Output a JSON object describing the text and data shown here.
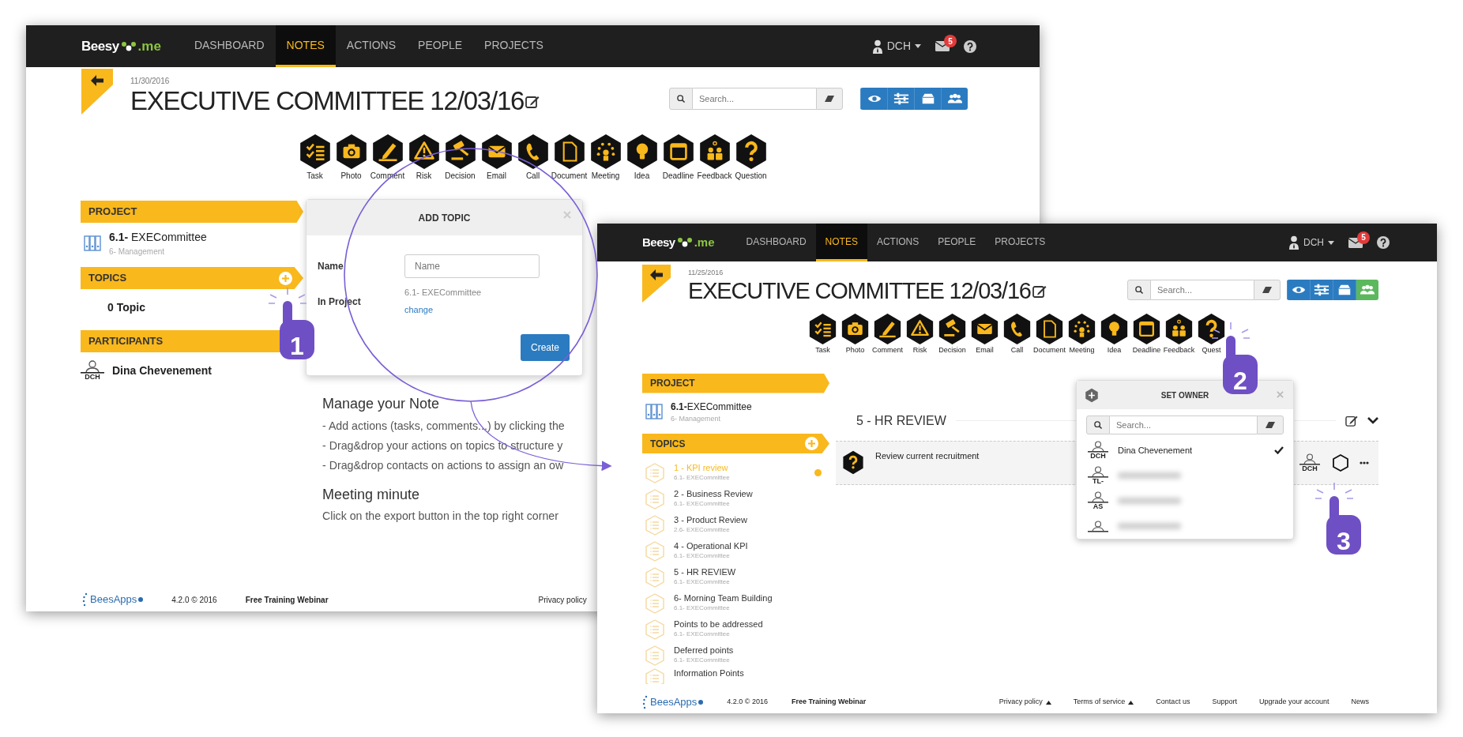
{
  "back_window": {
    "navbar": {
      "logo_name": "Beesy",
      "logo_suffix": ".me",
      "items": [
        {
          "label": "DASHBOARD",
          "selected": false
        },
        {
          "label": "NOTES",
          "selected": true
        },
        {
          "label": "ACTIONS",
          "selected": false
        },
        {
          "label": "PEOPLE",
          "selected": false
        },
        {
          "label": "PROJECTS",
          "selected": false
        }
      ],
      "user": "DCH",
      "mail_badge": "5"
    },
    "header": {
      "date": "11/30/2016",
      "title": "EXECUTIVE COMMITTEE 12/03/16",
      "search_placeholder": "Search...",
      "view_buttons": [
        {
          "kind": "eye",
          "active": false
        },
        {
          "kind": "sliders",
          "active": false
        },
        {
          "kind": "box",
          "active": false
        },
        {
          "kind": "people",
          "active": false
        }
      ]
    },
    "action_types": [
      {
        "label": "Task",
        "kind": "task"
      },
      {
        "label": "Photo",
        "kind": "photo"
      },
      {
        "label": "Comment",
        "kind": "comment"
      },
      {
        "label": "Risk",
        "kind": "risk"
      },
      {
        "label": "Decision",
        "kind": "decision"
      },
      {
        "label": "Email",
        "kind": "email"
      },
      {
        "label": "Call",
        "kind": "call"
      },
      {
        "label": "Document",
        "kind": "document"
      },
      {
        "label": "Meeting",
        "kind": "meeting"
      },
      {
        "label": "Idea",
        "kind": "idea"
      },
      {
        "label": "Deadline",
        "kind": "deadline"
      },
      {
        "label": "Feedback",
        "kind": "feedback"
      },
      {
        "label": "Question",
        "kind": "question"
      }
    ],
    "sidebar": {
      "project_header": "PROJECT",
      "project": {
        "name": "**6.1-** EXECommittee",
        "parent": "6- Management"
      },
      "topics_header": "TOPICS",
      "topics_empty": "0 Topic",
      "participants_header": "PARTICIPANTS",
      "participants": [
        {
          "initials": "DCH",
          "name": "Dina Chevenement"
        }
      ]
    },
    "main": [
      {
        "heading": "Manage your Note",
        "lines": [
          "- Add actions (tasks, comments...) by clicking the",
          "- Drag&drop your actions on topics to structure y",
          "- Drag&drop contacts on actions to assign an ow"
        ]
      },
      {
        "heading": "Meeting minute",
        "lines": [
          "Click on the export button in the top right corner"
        ]
      }
    ],
    "dialog": {
      "title": "ADD TOPIC",
      "name_label": "Name",
      "name_placeholder": "Name",
      "project_label": "In Project",
      "project_value": "6.1- EXECommittee",
      "change_link": "change",
      "button": "Create"
    },
    "footer": {
      "brand": "BeesApps",
      "version": "4.2.0 © 2016",
      "webinar": "Free Training Webinar",
      "links": [
        {
          "label": "Privacy policy"
        }
      ]
    }
  },
  "front_window": {
    "navbar": {
      "logo_name": "Beesy",
      "logo_suffix": ".me",
      "items": [
        {
          "label": "DASHBOARD",
          "selected": false
        },
        {
          "label": "NOTES",
          "selected": true
        },
        {
          "label": "ACTIONS",
          "selected": false
        },
        {
          "label": "PEOPLE",
          "selected": false
        },
        {
          "label": "PROJECTS",
          "selected": false
        }
      ],
      "user": "DCH",
      "mail_badge": "5"
    },
    "header": {
      "date": "11/25/2016",
      "title": "EXECUTIVE COMMITTEE 12/03/16",
      "search_placeholder": "Search...",
      "view_buttons": [
        {
          "kind": "eye",
          "active": false
        },
        {
          "kind": "sliders",
          "active": false
        },
        {
          "kind": "box",
          "active": false
        },
        {
          "kind": "people",
          "active": true
        }
      ]
    },
    "action_types": [
      {
        "label": "Task",
        "kind": "task"
      },
      {
        "label": "Photo",
        "kind": "photo"
      },
      {
        "label": "Comment",
        "kind": "comment"
      },
      {
        "label": "Risk",
        "kind": "risk"
      },
      {
        "label": "Decision",
        "kind": "decision"
      },
      {
        "label": "Email",
        "kind": "email"
      },
      {
        "label": "Call",
        "kind": "call"
      },
      {
        "label": "Document",
        "kind": "document"
      },
      {
        "label": "Meeting",
        "kind": "meeting"
      },
      {
        "label": "Idea",
        "kind": "idea"
      },
      {
        "label": "Deadline",
        "kind": "deadline"
      },
      {
        "label": "Feedback",
        "kind": "feedback"
      },
      {
        "label": "Quest",
        "kind": "question"
      }
    ],
    "sidebar": {
      "project_header": "PROJECT",
      "project": {
        "name": "**6.1-**EXECommittee",
        "parent": "6- Management"
      },
      "topics_header": "TOPICS",
      "topics": [
        {
          "title": "1 - KPI review",
          "project": "6.1- EXECommittee",
          "selected": true
        },
        {
          "title": "2 - Business Review",
          "project": "6.1- EXECommittee",
          "selected": false
        },
        {
          "title": "3 - Product Review",
          "project": "2.6- EXECommittee",
          "selected": false
        },
        {
          "title": "4 - Operational KPI",
          "project": "6.1- EXECommittee",
          "selected": false
        },
        {
          "title": "5 - HR REVIEW",
          "project": "6.1- EXECommittee",
          "selected": false
        },
        {
          "title": "6- Morning Team Building",
          "project": "6.1- EXECommittee",
          "selected": false
        },
        {
          "title": "Points to be addressed",
          "project": "6.1- EXECommittee",
          "selected": false
        },
        {
          "title": "Deferred points",
          "project": "6.1- EXECommittee",
          "selected": false
        },
        {
          "title": "Information Points",
          "selected": false
        }
      ]
    },
    "main": {
      "topic_title": "5 - HR REVIEW",
      "actions": [
        {
          "kind": "question",
          "text": "Review current recruitment",
          "owner": "DCH"
        }
      ]
    },
    "popup": {
      "title": "SET OWNER",
      "search_placeholder": "Search...",
      "people": [
        {
          "kind": "named",
          "initials": "DCH",
          "name": "Dina Chevenement",
          "selected": true
        },
        {
          "kind": "blurred",
          "initials": "TL-",
          "selected": false
        },
        {
          "kind": "blurred",
          "initials": "AS",
          "selected": false
        },
        {
          "kind": "blurred",
          "selected": false
        }
      ]
    },
    "footer": {
      "brand": "BeesApps",
      "version": "4.2.0 © 2016",
      "webinar": "Free Training Webinar",
      "links": [
        {
          "label": "Privacy policy",
          "kind": "dropdown"
        },
        {
          "label": "Terms of service",
          "kind": "dropdown"
        },
        {
          "label": "Contact us",
          "kind": "link"
        },
        {
          "label": "Support",
          "kind": "link"
        },
        {
          "label": "Upgrade your account",
          "kind": "link"
        },
        {
          "label": "News",
          "kind": "link"
        }
      ]
    }
  },
  "annotations": {
    "steps": [
      {
        "number": "1"
      },
      {
        "number": "2"
      },
      {
        "number": "3"
      }
    ]
  }
}
